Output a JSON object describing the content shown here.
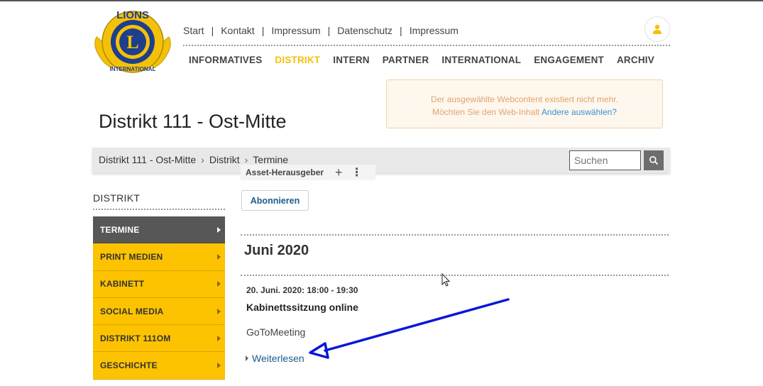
{
  "logo": {
    "text_top": "LIONS",
    "text_bottom": "INTERNATIONAL",
    "letter": "L",
    "colors": {
      "blue": "#1f3e8c",
      "gold": "#f4c10a"
    }
  },
  "topnav": {
    "items": [
      "Start",
      "Kontakt",
      "Impressum",
      "Datenschutz",
      "Impressum"
    ],
    "separator": "|"
  },
  "user_icon": "user-icon",
  "mainnav": {
    "items": [
      "INFORMATIVES",
      "DISTRIKT",
      "INTERN",
      "PARTNER",
      "INTERNATIONAL",
      "ENGAGEMENT",
      "ARCHIV"
    ],
    "active": "DISTRIKT"
  },
  "alert": {
    "line1": "Der ausgewählte Webcontent existiert nicht mehr.",
    "line2_prefix": "Möchten Sie den Web-Inhalt",
    "line2_link": "Andere auswählen?"
  },
  "page_title": "Distrikt 111 - Ost-Mitte",
  "breadcrumb": {
    "items": [
      "Distrikt 111 - Ost-Mitte",
      "Distrikt",
      "Termine"
    ]
  },
  "search": {
    "placeholder": "Suchen"
  },
  "asset_toolbar": {
    "label": "Asset-Herausgeber",
    "plus": "+",
    "more": "⋮"
  },
  "sidebar": {
    "heading": "DISTRIKT",
    "items": [
      {
        "label": "TERMINE",
        "active": true
      },
      {
        "label": "PRINT MEDIEN",
        "active": false
      },
      {
        "label": "KABINETT",
        "active": false
      },
      {
        "label": "SOCIAL MEDIA",
        "active": false
      },
      {
        "label": "DISTRIKT 111OM",
        "active": false
      },
      {
        "label": "GESCHICHTE",
        "active": false
      }
    ]
  },
  "content": {
    "subscribe_label": "Abonnieren",
    "month": "Juni 2020",
    "event": {
      "date": "20. Juni. 2020: 18:00 - 19:30",
      "title": "Kabinettssitzung online",
      "description": "GoToMeeting",
      "readmore": "Weiterlesen"
    }
  },
  "annotation": {
    "arrow_color": "#0a16d8"
  }
}
